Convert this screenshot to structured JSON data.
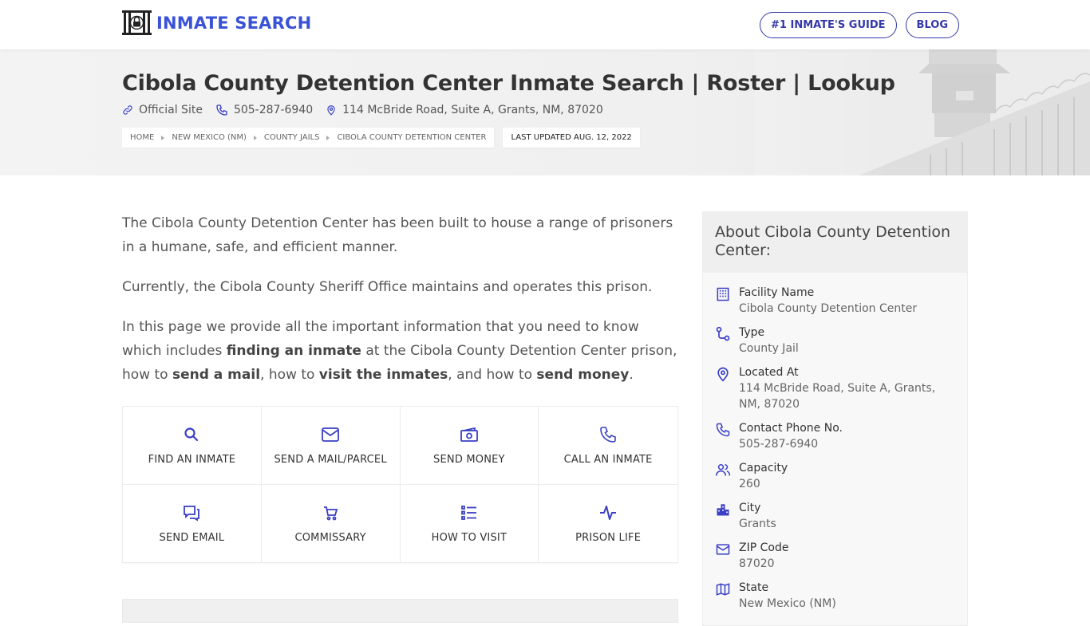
{
  "header": {
    "logo_text": "INMATE SEARCH",
    "nav": [
      {
        "label": "#1 INMATE'S GUIDE"
      },
      {
        "label": "BLOG"
      }
    ]
  },
  "hero": {
    "title": "Cibola County Detention Center Inmate Search | Roster | Lookup",
    "official_site": "Official Site",
    "phone": "505-287-6940",
    "address": "114 McBride Road, Suite A, Grants, NM, 87020",
    "breadcrumbs": [
      "HOME",
      "NEW MEXICO (NM)",
      "COUNTY JAILS",
      "CIBOLA COUNTY DETENTION CENTER"
    ],
    "last_updated": "LAST UPDATED AUG. 12, 2022"
  },
  "main": {
    "p1": "The Cibola County Detention Center has been built to house a range of prisoners in a humane, safe, and efficient manner.",
    "p2": "Currently, the Cibola County Sheriff Office maintains and operates this prison.",
    "p3": {
      "t1": "In this page we provide all the important information that you need to know which includes ",
      "b1": "finding an inmate",
      "t2": " at the Cibola County Detention Center prison, how to ",
      "b2": "send a mail",
      "t3": ", how to ",
      "b3": "visit the inmates",
      "t4": ", and how to ",
      "b4": "send money",
      "t5": "."
    },
    "tiles": [
      {
        "label": "FIND AN INMATE",
        "icon": "search-icon"
      },
      {
        "label": "SEND A MAIL/PARCEL",
        "icon": "envelope-icon"
      },
      {
        "label": "SEND MONEY",
        "icon": "money-icon"
      },
      {
        "label": "CALL AN INMATE",
        "icon": "phone-icon"
      },
      {
        "label": "SEND EMAIL",
        "icon": "chat-icon"
      },
      {
        "label": "COMMISSARY",
        "icon": "cart-icon"
      },
      {
        "label": "HOW TO VISIT",
        "icon": "list-icon"
      },
      {
        "label": "PRISON LIFE",
        "icon": "pulse-icon"
      }
    ]
  },
  "sidebar": {
    "title": "About Cibola County Detention Center:",
    "items": [
      {
        "label": "Facility Name",
        "value": "Cibola County Detention Center",
        "icon": "building-icon"
      },
      {
        "label": "Type",
        "value": "County Jail",
        "icon": "route-icon"
      },
      {
        "label": "Located At",
        "value": "114 McBride Road, Suite A, Grants, NM, 87020",
        "icon": "location-icon"
      },
      {
        "label": "Contact Phone No.",
        "value": "505-287-6940",
        "icon": "phone-icon"
      },
      {
        "label": "Capacity",
        "value": "260",
        "icon": "users-icon"
      },
      {
        "label": "City",
        "value": "Grants",
        "icon": "city-icon"
      },
      {
        "label": "ZIP Code",
        "value": "87020",
        "icon": "envelope-icon"
      },
      {
        "label": "State",
        "value": "New Mexico (NM)",
        "icon": "map-icon"
      }
    ]
  },
  "colors": {
    "accent": "#3a52d6",
    "nav_border": "#3438a8",
    "icon": "#3a3fc4"
  }
}
